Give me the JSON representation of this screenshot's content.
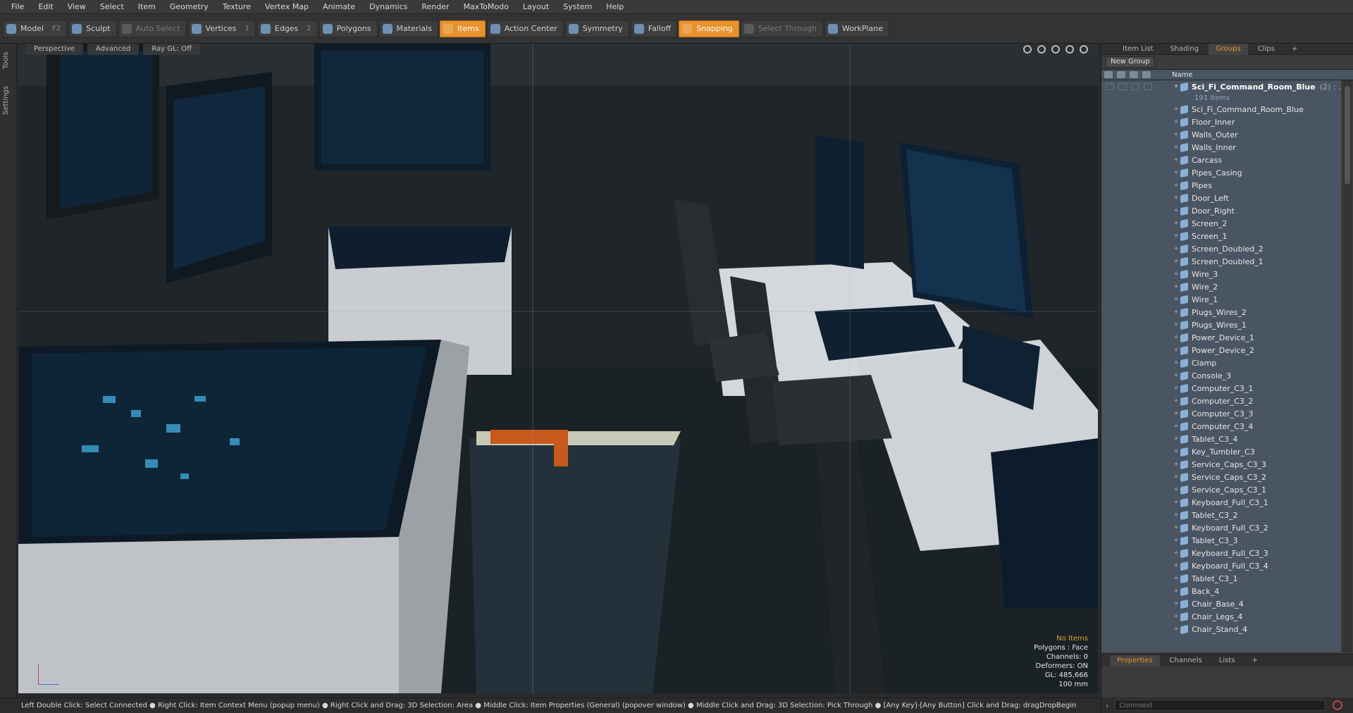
{
  "menu": [
    "File",
    "Edit",
    "View",
    "Select",
    "Item",
    "Geometry",
    "Texture",
    "Vertex Map",
    "Animate",
    "Dynamics",
    "Render",
    "MaxToModo",
    "Layout",
    "System",
    "Help"
  ],
  "toolbar": [
    {
      "label": "Model",
      "hotkey": "F2",
      "state": "normal"
    },
    {
      "label": "Sculpt",
      "hotkey": "",
      "state": "normal"
    },
    {
      "label": "Auto Select",
      "hotkey": "",
      "state": "dim"
    },
    {
      "label": "Vertices",
      "hotkey": "1",
      "state": "normal"
    },
    {
      "label": "Edges",
      "hotkey": "2",
      "state": "normal"
    },
    {
      "label": "Polygons",
      "hotkey": "",
      "state": "normal"
    },
    {
      "label": "Materials",
      "hotkey": "",
      "state": "normal"
    },
    {
      "label": "Items",
      "hotkey": "",
      "state": "active"
    },
    {
      "label": "Action Center",
      "hotkey": "",
      "state": "normal"
    },
    {
      "label": "Symmetry",
      "hotkey": "",
      "state": "normal"
    },
    {
      "label": "Falloff",
      "hotkey": "",
      "state": "normal"
    },
    {
      "label": "Snapping",
      "hotkey": "",
      "state": "active"
    },
    {
      "label": "Select Through",
      "hotkey": "",
      "state": "dim"
    },
    {
      "label": "WorkPlane",
      "hotkey": "",
      "state": "normal"
    }
  ],
  "left_tabs": {
    "tools": "Tools",
    "settings": "Settings"
  },
  "viewport": {
    "view": "Perspective",
    "shading": "Advanced",
    "raygl": "Ray GL: Off",
    "info": {
      "no_items": "No Items",
      "polygons": "Polygons : Face",
      "channels": "Channels: 0",
      "deformers": "Deformers: ON",
      "gl": "GL: 485,666",
      "scale": "100 mm"
    }
  },
  "status_bar": "Left Double Click: Select Connected ● Right Click: Item Context Menu (popup menu) ● Right Click and Drag: 3D Selection: Area ● Middle Click: Item Properties (General) (popover window) ● Middle Click and Drag: 3D Selection: Pick Through ● [Any Key]-[Any Button] Click and Drag: dragDropBegin",
  "right_panel": {
    "tabs": [
      "Item List",
      "Shading",
      "Groups",
      "Clips",
      "+"
    ],
    "active_tab": "Groups",
    "new_group": "New Group",
    "column_name": "Name",
    "root": {
      "label": "Sci_Fi_Command_Room_Blue",
      "count": "(2) : ...",
      "sub": "191 Items"
    },
    "items": [
      "Sci_Fi_Command_Room_Blue",
      "Floor_Inner",
      "Walls_Outer",
      "Walls_Inner",
      "Carcass",
      "Pipes_Casing",
      "Pipes",
      "Door_Left",
      "Door_Right",
      "Screen_2",
      "Screen_1",
      "Screen_Doubled_2",
      "Screen_Doubled_1",
      "Wire_3",
      "Wire_2",
      "Wire_1",
      "Plugs_Wires_2",
      "Plugs_Wires_1",
      "Power_Device_1",
      "Power_Device_2",
      "Clamp",
      "Console_3",
      "Computer_C3_1",
      "Computer_C3_2",
      "Computer_C3_3",
      "Computer_C3_4",
      "Tablet_C3_4",
      "Key_Tumbler_C3",
      "Service_Caps_C3_3",
      "Service_Caps_C3_2",
      "Service_Caps_C3_1",
      "Keyboard_Full_C3_1",
      "Tablet_C3_2",
      "Keyboard_Full_C3_2",
      "Tablet_C3_3",
      "Keyboard_Full_C3_3",
      "Keyboard_Full_C3_4",
      "Tablet_C3_1",
      "Back_4",
      "Chair_Base_4",
      "Chair_Legs_4",
      "Chair_Stand_4"
    ],
    "bottom_tabs": [
      "Properties",
      "Channels",
      "Lists",
      "+"
    ],
    "command_placeholder": "Command"
  }
}
